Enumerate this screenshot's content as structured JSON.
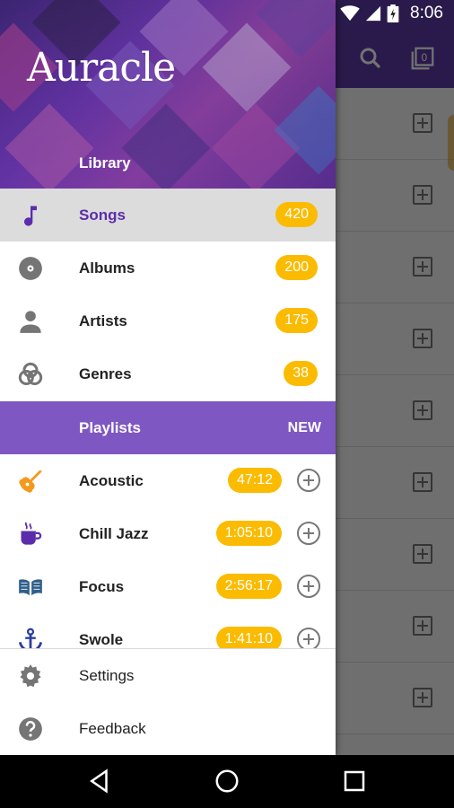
{
  "status_bar": {
    "time": "8:06"
  },
  "drawer": {
    "brand": "Auracle",
    "library_label": "Library",
    "library_items": [
      {
        "label": "Songs",
        "count": "420",
        "icon": "music-note-icon",
        "selected": true
      },
      {
        "label": "Albums",
        "count": "200",
        "icon": "disc-icon"
      },
      {
        "label": "Artists",
        "count": "175",
        "icon": "person-icon"
      },
      {
        "label": "Genres",
        "count": "38",
        "icon": "genres-icon"
      }
    ],
    "playlists_label": "Playlists",
    "new_label": "NEW",
    "playlists": [
      {
        "label": "Acoustic",
        "duration": "47:12",
        "icon": "guitar-icon"
      },
      {
        "label": "Chill Jazz",
        "duration": "1:05:10",
        "icon": "coffee-cup-icon"
      },
      {
        "label": "Focus",
        "duration": "2:56:17",
        "icon": "open-book-icon"
      },
      {
        "label": "Swole",
        "duration": "1:41:10",
        "icon": "anchor-icon"
      }
    ],
    "settings_label": "Settings",
    "feedback_label": "Feedback"
  },
  "colors": {
    "primary": "#5b3aa6",
    "playlist_header": "#7f57c2",
    "selected_text": "#5b2dab",
    "badge": "#fbbb00"
  }
}
